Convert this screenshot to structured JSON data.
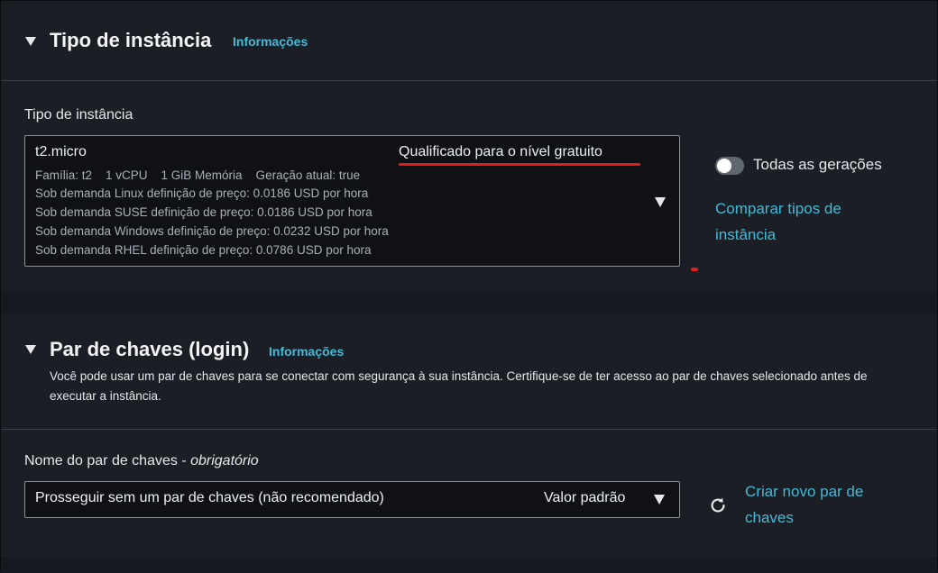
{
  "instance_section": {
    "title": "Tipo de instância",
    "info_link": "Informações",
    "field_label": "Tipo de instância",
    "selected": {
      "name": "t2.micro",
      "free_tier_badge": "Qualificado para o nível gratuito",
      "specs": "Família: t2    1 vCPU    1 GiB Memória    Geração atual: true",
      "pricing": [
        "Sob demanda Linux definição de preço: 0.0186 USD por hora",
        "Sob demanda SUSE definição de preço: 0.0186 USD por hora",
        "Sob demanda Windows definição de preço: 0.0232 USD por hora",
        "Sob demanda RHEL definição de preço: 0.0786 USD por hora"
      ]
    },
    "toggle_label": "Todas as gerações",
    "toggle_on": false,
    "compare_link_line1": "Comparar tipos de",
    "compare_link_line2": "instância"
  },
  "keypair_section": {
    "title": "Par de chaves (login)",
    "info_link": "Informações",
    "description": "Você pode usar um par de chaves para se conectar com segurança à sua instância. Certifique-se de ter acesso ao par de chaves selecionado antes de executar a instância.",
    "field_label_main": "Nome do par de chaves - ",
    "field_label_required": "obrigatório",
    "selected_value": "Prosseguir sem um par de chaves (não recomendado)",
    "default_tag": "Valor padrão",
    "create_link_line1": "Criar novo par de",
    "create_link_line2": "chaves"
  },
  "colors": {
    "link": "#44b9d6",
    "annotation_red": "#e11d1d",
    "panel": "#1b1f25",
    "input_bg": "#0f1114"
  }
}
